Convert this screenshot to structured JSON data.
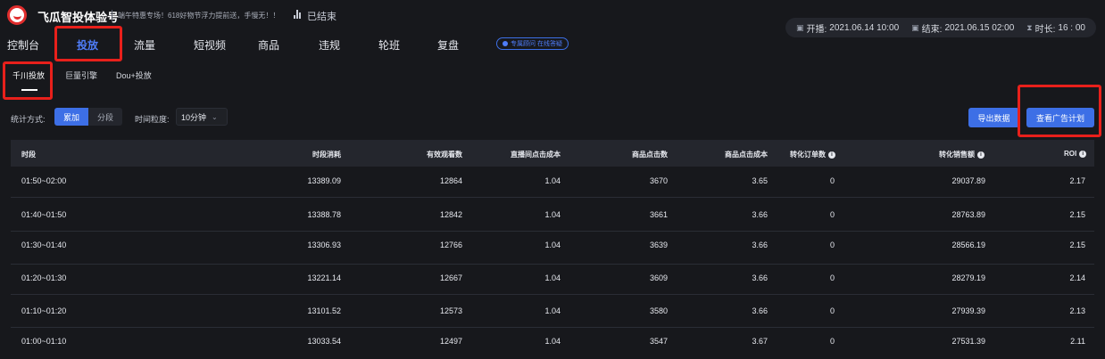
{
  "header": {
    "brand": "飞瓜智投体验号",
    "slogan": "端午特惠专场！618好物节浮力提前送，手慢无！！",
    "status": "已结束",
    "start_label": "开播:",
    "start_value": "2021.06.14 10:00",
    "end_label": "结束:",
    "end_value": "2021.06.15 02:00",
    "duration_label": "时长:",
    "duration_value": "16 : 00"
  },
  "nav": {
    "items": [
      "控制台",
      "投放",
      "流量",
      "短视频",
      "商品",
      "违规",
      "轮班",
      "复盘"
    ],
    "active": "投放",
    "consult": "专属顾问 在线答疑"
  },
  "subnav": {
    "items": [
      "千川投放",
      "巨量引擎",
      "Dou+投放"
    ],
    "active": "千川投放"
  },
  "filters": {
    "method_label": "统计方式:",
    "method_options": [
      "累加",
      "分段"
    ],
    "method_selected": "累加",
    "granularity_label": "时间粒度:",
    "granularity_value": "10分钟"
  },
  "actions": {
    "export": "导出数据",
    "view_plans": "查看广告计划"
  },
  "table": {
    "columns": [
      "时段",
      "时段消耗",
      "有效观看数",
      "直播间点击成本",
      "商品点击数",
      "商品点击成本",
      "转化订单数",
      "转化销售额",
      "ROI"
    ],
    "rows": [
      [
        "01:50~02:00",
        "13389.09",
        "12864",
        "1.04",
        "3670",
        "3.65",
        "0",
        "29037.89",
        "2.17"
      ],
      [
        "01:40~01:50",
        "13388.78",
        "12842",
        "1.04",
        "3661",
        "3.66",
        "0",
        "28763.89",
        "2.15"
      ],
      [
        "01:30~01:40",
        "13306.93",
        "12766",
        "1.04",
        "3639",
        "3.66",
        "0",
        "28566.19",
        "2.15"
      ],
      [
        "01:20~01:30",
        "13221.14",
        "12667",
        "1.04",
        "3609",
        "3.66",
        "0",
        "28279.19",
        "2.14"
      ],
      [
        "01:10~01:20",
        "13101.52",
        "12573",
        "1.04",
        "3580",
        "3.66",
        "0",
        "27939.39",
        "2.13"
      ],
      [
        "01:00~01:10",
        "13033.54",
        "12497",
        "1.04",
        "3547",
        "3.67",
        "0",
        "27531.39",
        "2.11"
      ]
    ]
  },
  "colors": {
    "background": "#17181c",
    "accent": "#3d6fe6",
    "highlight": "#e8201b"
  }
}
